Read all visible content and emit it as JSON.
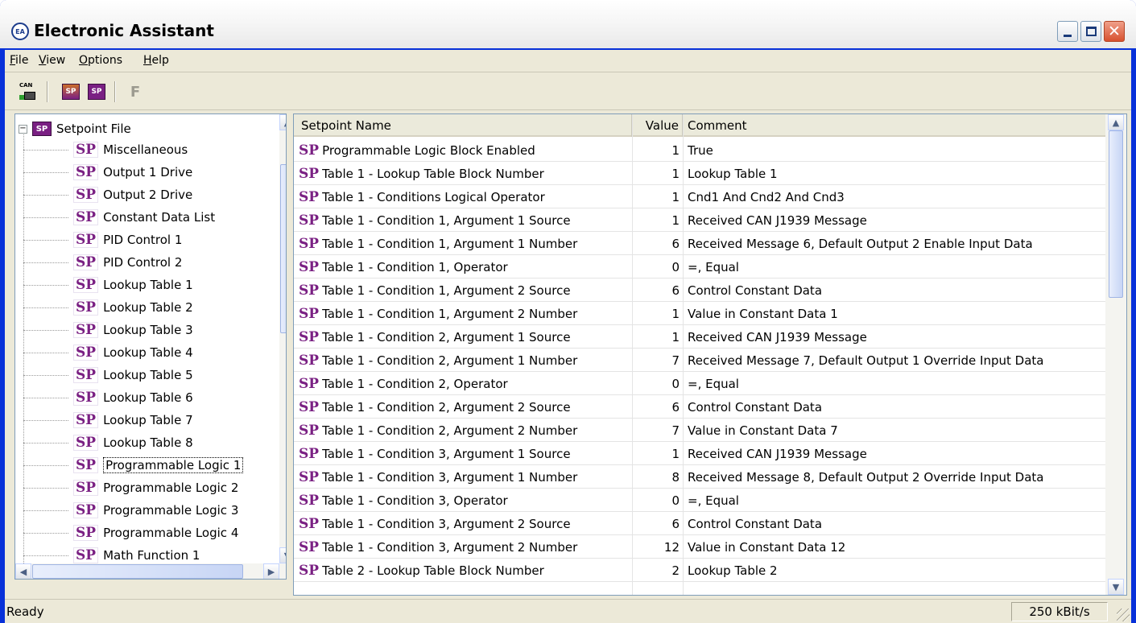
{
  "window": {
    "title": "Electronic Assistant",
    "icon": "app-logo-icon"
  },
  "menu": [
    {
      "label": "File",
      "accel": "F",
      "rest": "ile"
    },
    {
      "label": "View",
      "accel": "V",
      "rest": "iew"
    },
    {
      "label": "Options",
      "accel": "O",
      "rest": "ptions"
    },
    {
      "label": "Help",
      "accel": "H",
      "rest": "elp"
    }
  ],
  "toolbar": {
    "can_label": "CAN",
    "sp_label": "SP",
    "f_label": "F"
  },
  "tree": {
    "root": {
      "label": "Setpoint File",
      "icon_text": "SP",
      "expander": "−"
    },
    "badge": "SP",
    "items": [
      "Miscellaneous",
      "Output 1 Drive",
      "Output 2 Drive",
      "Constant Data List",
      "PID Control 1",
      "PID Control 2",
      "Lookup Table 1",
      "Lookup Table 2",
      "Lookup Table 3",
      "Lookup Table 4",
      "Lookup Table 5",
      "Lookup Table 6",
      "Lookup Table 7",
      "Lookup Table 8",
      "Programmable Logic 1",
      "Programmable Logic 2",
      "Programmable Logic 3",
      "Programmable Logic 4",
      "Math Function 1"
    ],
    "selected_index": 14
  },
  "grid": {
    "headers": {
      "name": "Setpoint Name",
      "value": "Value",
      "comment": "Comment"
    },
    "badge": "SP",
    "rows": [
      {
        "name": "Programmable Logic Block Enabled",
        "value": "1",
        "comment": "True"
      },
      {
        "name": "Table 1 - Lookup Table Block Number",
        "value": "1",
        "comment": "Lookup Table 1"
      },
      {
        "name": "Table 1 - Conditions Logical Operator",
        "value": "1",
        "comment": "Cnd1 And Cnd2 And Cnd3"
      },
      {
        "name": "Table 1 - Condition 1, Argument 1 Source",
        "value": "1",
        "comment": "Received CAN J1939 Message"
      },
      {
        "name": "Table 1 - Condition 1, Argument 1 Number",
        "value": "6",
        "comment": "Received Message 6, Default Output 2 Enable Input Data"
      },
      {
        "name": "Table 1 - Condition 1, Operator",
        "value": "0",
        "comment": "=, Equal"
      },
      {
        "name": "Table 1 - Condition 1, Argument 2 Source",
        "value": "6",
        "comment": "Control Constant Data"
      },
      {
        "name": "Table 1 - Condition 1, Argument 2 Number",
        "value": "1",
        "comment": "Value in Constant Data 1"
      },
      {
        "name": "Table 1 - Condition 2, Argument 1 Source",
        "value": "1",
        "comment": "Received CAN J1939 Message"
      },
      {
        "name": "Table 1 - Condition 2, Argument 1 Number",
        "value": "7",
        "comment": "Received Message 7, Default Output 1 Override Input Data"
      },
      {
        "name": "Table 1 - Condition 2, Operator",
        "value": "0",
        "comment": "=, Equal"
      },
      {
        "name": "Table 1 - Condition 2, Argument 2 Source",
        "value": "6",
        "comment": "Control Constant Data"
      },
      {
        "name": "Table 1 - Condition 2, Argument 2 Number",
        "value": "7",
        "comment": "Value in Constant Data 7"
      },
      {
        "name": "Table 1 - Condition 3, Argument 1 Source",
        "value": "1",
        "comment": "Received CAN J1939 Message"
      },
      {
        "name": "Table 1 - Condition 3, Argument 1 Number",
        "value": "8",
        "comment": "Received Message 8, Default Output 2 Override Input Data"
      },
      {
        "name": "Table 1 - Condition 3, Operator",
        "value": "0",
        "comment": "=, Equal"
      },
      {
        "name": "Table 1 - Condition 3, Argument 2 Source",
        "value": "6",
        "comment": "Control Constant Data"
      },
      {
        "name": "Table 1 - Condition 3, Argument 2 Number",
        "value": "12",
        "comment": "Value in Constant Data 12"
      },
      {
        "name": "Table 2 - Lookup Table Block Number",
        "value": "2",
        "comment": "Lookup Table 2"
      }
    ]
  },
  "status": {
    "text": "Ready",
    "baud": "250 kBit/s"
  }
}
